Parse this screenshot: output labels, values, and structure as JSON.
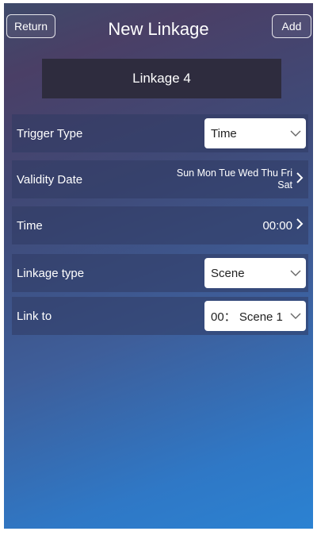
{
  "header": {
    "return_label": "Return",
    "title": "New Linkage",
    "add_label": "Add"
  },
  "linkage_name": "Linkage 4",
  "rows": {
    "trigger_type": {
      "label": "Trigger Type",
      "value": "Time"
    },
    "validity_date": {
      "label": "Validity Date",
      "days_line1": "Sun Mon Tue Wed Thu Fri",
      "days_line2": "Sat"
    },
    "time": {
      "label": "Time",
      "value": "00:00"
    },
    "linkage_type": {
      "label": "Linkage type",
      "value": "Scene"
    },
    "link_to": {
      "label": "Link to",
      "value": "00： Scene 1"
    }
  },
  "icons": {
    "dropdown": "chevron-down-icon",
    "navigate": "chevron-right-icon"
  }
}
